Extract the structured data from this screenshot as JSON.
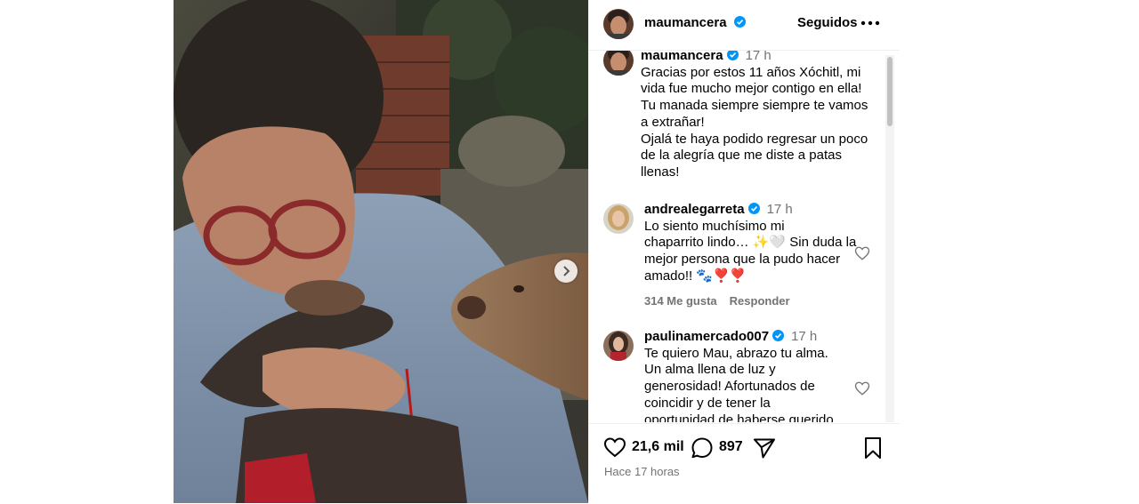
{
  "post": {
    "author": "maumancera",
    "follow_state": "Seguidos",
    "caption": {
      "author": "maumancera",
      "time": "17 h",
      "lines": [
        "Gracias por estos 11 años Xóchitl, mi",
        "vida fue mucho mejor contigo en ella!",
        "Tu manada siempre siempre te vamos",
        "a extrañar!",
        "Ojalá te haya podido regresar un poco",
        "de la alegría que me diste a patas",
        "llenas!"
      ]
    },
    "comments": [
      {
        "author": "andrealegarreta",
        "time": "17 h",
        "lines": [
          "Lo siento muchísimo mi",
          "chaparrito lindo… ✨🤍 Sin duda la",
          "mejor persona que la pudo hacer",
          "amado!! 🐾❣️❣️"
        ],
        "likes": "314 Me gusta",
        "reply": "Responder"
      },
      {
        "author": "paulinamercado007",
        "time": "17 h",
        "lines": [
          "Te quiero Mau, abrazo tu alma.",
          "Un alma llena de luz y",
          "generosidad! Afortunados de",
          "coincidir y de tener la",
          "oportunidad de haberse querido"
        ]
      }
    ],
    "like_count": "21,6 mil",
    "comment_count": "897",
    "posted_ago": "Hace 17 horas"
  },
  "icons": {
    "verified": "verified-badge-icon",
    "more": "more-options-icon",
    "like": "heart-icon",
    "comment": "comment-icon",
    "share": "send-icon",
    "save": "bookmark-icon",
    "next": "chevron-right-icon"
  },
  "colors": {
    "verified": "#0095f6",
    "muted": "#737373",
    "divider": "#efefef"
  }
}
